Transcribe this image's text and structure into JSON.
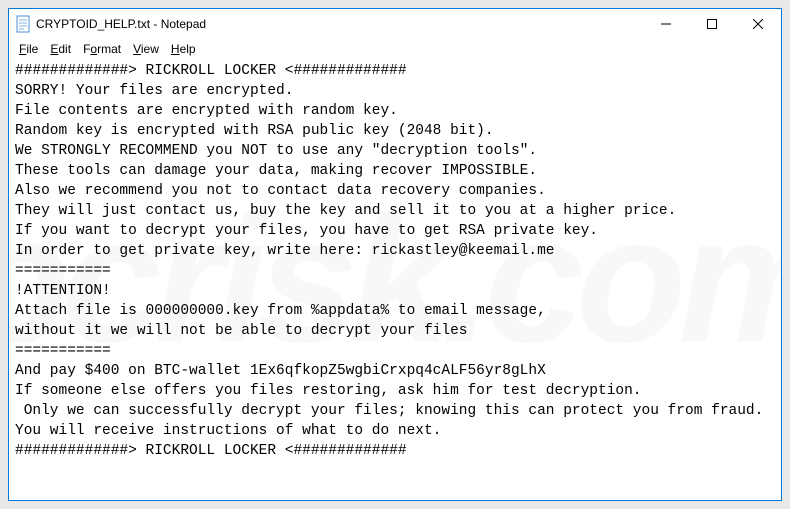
{
  "window": {
    "title": "CRYPTOID_HELP.txt - Notepad"
  },
  "menubar": {
    "items": [
      {
        "label": "File",
        "key": "F"
      },
      {
        "label": "Edit",
        "key": "E"
      },
      {
        "label": "Format",
        "key": "o"
      },
      {
        "label": "View",
        "key": "V"
      },
      {
        "label": "Help",
        "key": "H"
      }
    ]
  },
  "content": {
    "text": "#############> RICKROLL LOCKER <#############\nSORRY! Your files are encrypted.\nFile contents are encrypted with random key.\nRandom key is encrypted with RSA public key (2048 bit).\nWe STRONGLY RECOMMEND you NOT to use any \"decryption tools\".\nThese tools can damage your data, making recover IMPOSSIBLE.\nAlso we recommend you not to contact data recovery companies.\nThey will just contact us, buy the key and sell it to you at a higher price.\nIf you want to decrypt your files, you have to get RSA private key.\nIn order to get private key, write here: rickastley@keemail.me\n===========\n!ATTENTION!\nAttach file is 000000000.key from %appdata% to email message,\nwithout it we will not be able to decrypt your files\n===========\nAnd pay $400 on BTC-wallet 1Ex6qfkopZ5wgbiCrxpq4cALF56yr8gLhX\nIf someone else offers you files restoring, ask him for test decryption.\n Only we can successfully decrypt your files; knowing this can protect you from fraud.\nYou will receive instructions of what to do next.\n#############> RICKROLL LOCKER <#############"
  },
  "watermark": "pcrisk.com"
}
